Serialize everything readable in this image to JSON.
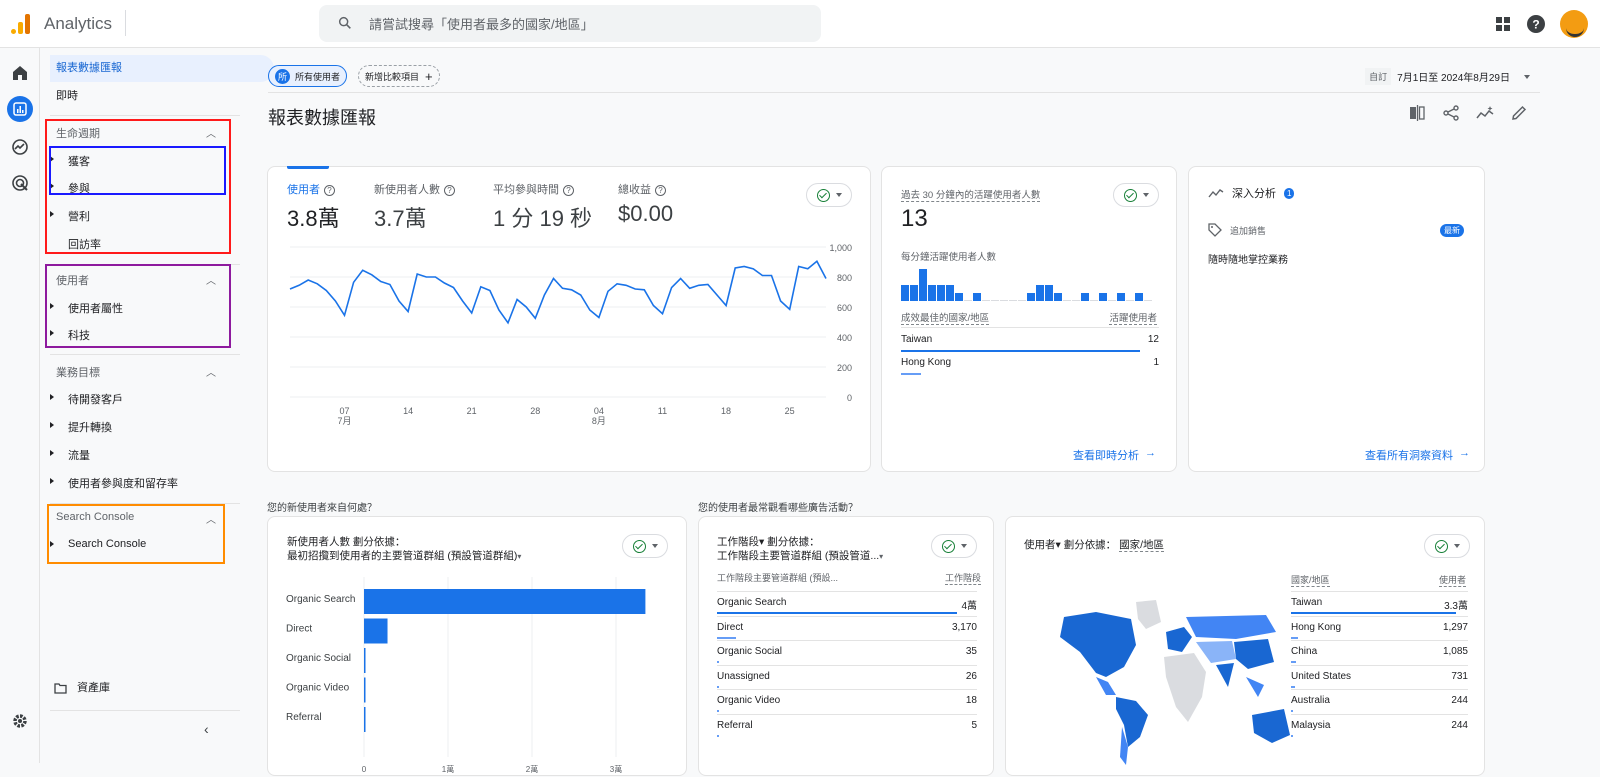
{
  "topbar": {
    "app_title": "Analytics",
    "search_placeholder": "請嘗試搜尋「使用者最多的國家/地區」",
    "icons": [
      "apps-grid-icon",
      "help-icon",
      "account-avatar"
    ]
  },
  "rail": {
    "items": [
      "home-icon",
      "reports-icon",
      "explore-icon",
      "advertising-icon"
    ],
    "settings": "settings-icon"
  },
  "nav": {
    "top_items": [
      {
        "label": "報表數據匯報",
        "selected": true
      },
      {
        "label": "即時",
        "selected": false
      }
    ],
    "sections": [
      {
        "title": "生命週期",
        "items": [
          {
            "label": "獲客",
            "expandable": true
          },
          {
            "label": "參與",
            "expandable": true
          },
          {
            "label": "營利",
            "expandable": true
          },
          {
            "label": "回訪率",
            "expandable": false
          }
        ]
      },
      {
        "title": "使用者",
        "items": [
          {
            "label": "使用者屬性",
            "expandable": true
          },
          {
            "label": "科技",
            "expandable": true
          }
        ]
      },
      {
        "title": "業務目標",
        "items": [
          {
            "label": "待開發客戶",
            "expandable": true
          },
          {
            "label": "提升轉換",
            "expandable": true
          },
          {
            "label": "流量",
            "expandable": true
          },
          {
            "label": "使用者參與度和留存率",
            "expandable": true
          }
        ]
      },
      {
        "title": "Search Console",
        "items": [
          {
            "label": "Search Console",
            "expandable": true
          }
        ]
      }
    ],
    "library_label": "資產庫",
    "highlight_colors": {
      "lifecycle": "#ff1a1a",
      "acq_engage": "#1a1aff",
      "user": "#8e1a9e",
      "search_console": "#ff8c00"
    }
  },
  "header": {
    "segment_chip": {
      "badge": "所",
      "label": "所有使用者"
    },
    "add_compare": "新增比較項目",
    "date_label": "自訂",
    "date_range": "7月1日至 2024年8月29日",
    "page_title": "報表數據匯報",
    "tools": [
      "compare-icon",
      "share-icon",
      "insights-icon",
      "edit-icon"
    ]
  },
  "overview_card": {
    "metrics": [
      {
        "label": "使用者",
        "value": "3.8萬",
        "active": true
      },
      {
        "label": "新使用者人數",
        "value": "3.7萬",
        "active": false
      },
      {
        "label": "平均參與時間",
        "value": "1 分 19 秒",
        "active": false
      },
      {
        "label": "總收益",
        "value": "$0.00",
        "active": false
      }
    ]
  },
  "realtime_card": {
    "title": "過去 30 分鐘內的活躍使用者人數",
    "value": "13",
    "subtitle": "每分鐘活躍使用者人數",
    "minute_bars": [
      2,
      2,
      4,
      2,
      2,
      2,
      1,
      0,
      1,
      0,
      0,
      0,
      0,
      0,
      1,
      2,
      2,
      1,
      0,
      0,
      1,
      0,
      1,
      0,
      1,
      0,
      1,
      0
    ],
    "col_country": "成效最佳的國家/地區",
    "col_users": "活躍使用者",
    "rows": [
      {
        "country": "Taiwan",
        "value": "12",
        "share": 0.92
      },
      {
        "country": "Hong Kong",
        "value": "1",
        "share": 0.08
      }
    ],
    "link": "查看即時分析"
  },
  "insights_card": {
    "title": "深入分析",
    "badge": "1",
    "tag_label": "追加銷售",
    "new_badge": "最新",
    "text": "隨時隨地掌控業務",
    "link": "查看所有洞察資料"
  },
  "section_questions": {
    "q1": "您的新使用者來自何處？",
    "q2": "您的使用者最常觀看哪些廣告活動？"
  },
  "acquisition_card": {
    "title_line1": "新使用者人數 劃分依據：",
    "title_metric": "新使用者人數",
    "title_line2": "最初招攬到使用者的主要管道群組 (預設管道群組)"
  },
  "session_card": {
    "title_line1": "工作階段▾ 劃分依據：",
    "title_line2": "工作階段主要管道群組 (預設管道...",
    "col_channel": "工作階段主要管道群組 (預設...",
    "col_value": "工作階段",
    "rows": [
      {
        "label": "Organic Search",
        "value": "4萬",
        "share": 1.0
      },
      {
        "label": "Direct",
        "value": "3,170",
        "share": 0.08
      },
      {
        "label": "Organic Social",
        "value": "35",
        "share": 0.003
      },
      {
        "label": "Unassigned",
        "value": "26",
        "share": 0.003
      },
      {
        "label": "Organic Video",
        "value": "18",
        "share": 0.002
      },
      {
        "label": "Referral",
        "value": "5",
        "share": 0.001
      }
    ]
  },
  "country_card": {
    "title_prefix": "使用者▾ 劃分依據：",
    "title_dim": "國家/地區",
    "col_country": "國家/地區",
    "col_users": "使用者",
    "rows": [
      {
        "country": "Taiwan",
        "value": "3.3萬",
        "share": 1.0
      },
      {
        "country": "Hong Kong",
        "value": "1,297",
        "share": 0.04
      },
      {
        "country": "China",
        "value": "1,085",
        "share": 0.033
      },
      {
        "country": "United States",
        "value": "731",
        "share": 0.022
      },
      {
        "country": "Australia",
        "value": "244",
        "share": 0.007
      },
      {
        "country": "Malaysia",
        "value": "244",
        "share": 0.007
      }
    ]
  },
  "chart_data": [
    {
      "type": "line",
      "title": "使用者",
      "x_tick_labels": [
        "07\n7月",
        "14",
        "21",
        "28",
        "04\n8月",
        "11",
        "18",
        "25"
      ],
      "x_start": "2024-07-01",
      "x_end": "2024-08-29",
      "y_ticks": [
        "0",
        "200",
        "400",
        "600",
        "800",
        "1,000"
      ],
      "ylim": [
        0,
        1000
      ],
      "grid": true,
      "series": [
        {
          "name": "使用者",
          "values": [
            720,
            745,
            780,
            755,
            710,
            640,
            545,
            765,
            845,
            815,
            770,
            750,
            640,
            570,
            820,
            800,
            800,
            760,
            730,
            640,
            560,
            735,
            710,
            580,
            495,
            650,
            600,
            525,
            680,
            790,
            725,
            715,
            680,
            580,
            530,
            705,
            755,
            745,
            720,
            715,
            610,
            555,
            730,
            790,
            725,
            745,
            750,
            680,
            610,
            860,
            870,
            855,
            810,
            810,
            640,
            585,
            870,
            855,
            905,
            790
          ]
        }
      ]
    },
    {
      "type": "bar",
      "orientation": "horizontal",
      "title": "新使用者人數 劃分依據：最初招攬到使用者的主要管道群組 (預設管道群組)",
      "categories": [
        "Organic Search",
        "Direct",
        "Organic Social",
        "Organic Video",
        "Referral"
      ],
      "values": [
        33500,
        2800,
        30,
        15,
        5
      ],
      "x_ticks": [
        "0",
        "1萬",
        "2萬",
        "3萬"
      ],
      "xlim": [
        0,
        35000
      ],
      "grid": true
    }
  ]
}
